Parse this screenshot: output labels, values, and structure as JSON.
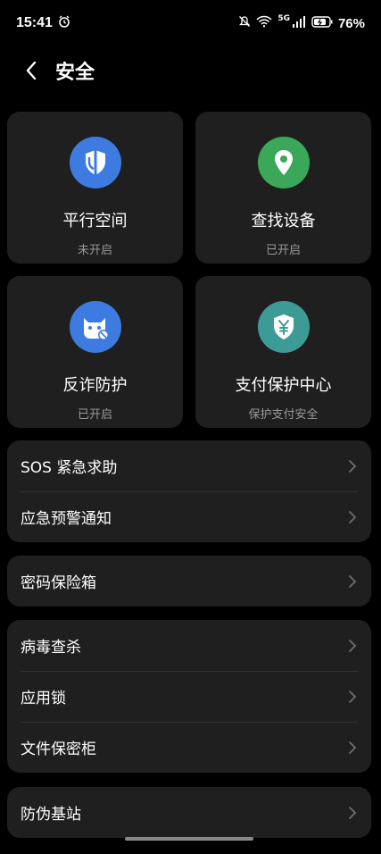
{
  "status_bar": {
    "time": "15:41",
    "network": "5G",
    "battery": "76%"
  },
  "header": {
    "title": "安全"
  },
  "cards": [
    {
      "title": "平行空间",
      "subtitle": "未开启",
      "icon": "shield-split-icon",
      "color": "#3d7be0"
    },
    {
      "title": "查找设备",
      "subtitle": "已开启",
      "icon": "location-pin-icon",
      "color": "#3aa858"
    },
    {
      "title": "反诈防护",
      "subtitle": "已开启",
      "icon": "anti-fraud-icon",
      "color": "#3d7be0"
    },
    {
      "title": "支付保护中心",
      "subtitle": "保护支付安全",
      "icon": "payment-shield-icon",
      "color": "#3d9b96"
    }
  ],
  "groups": [
    {
      "items": [
        "SOS 紧急求助",
        "应急预警通知"
      ]
    },
    {
      "items": [
        "密码保险箱"
      ]
    },
    {
      "items": [
        "病毒查杀",
        "应用锁",
        "文件保密柜"
      ]
    },
    {
      "items": [
        "防伪基站"
      ]
    }
  ],
  "colors": {
    "background": "#000000",
    "card_bg": "#1f1f1f",
    "secondary_text": "#9a9a9a",
    "chevron": "#6e6e6e"
  }
}
